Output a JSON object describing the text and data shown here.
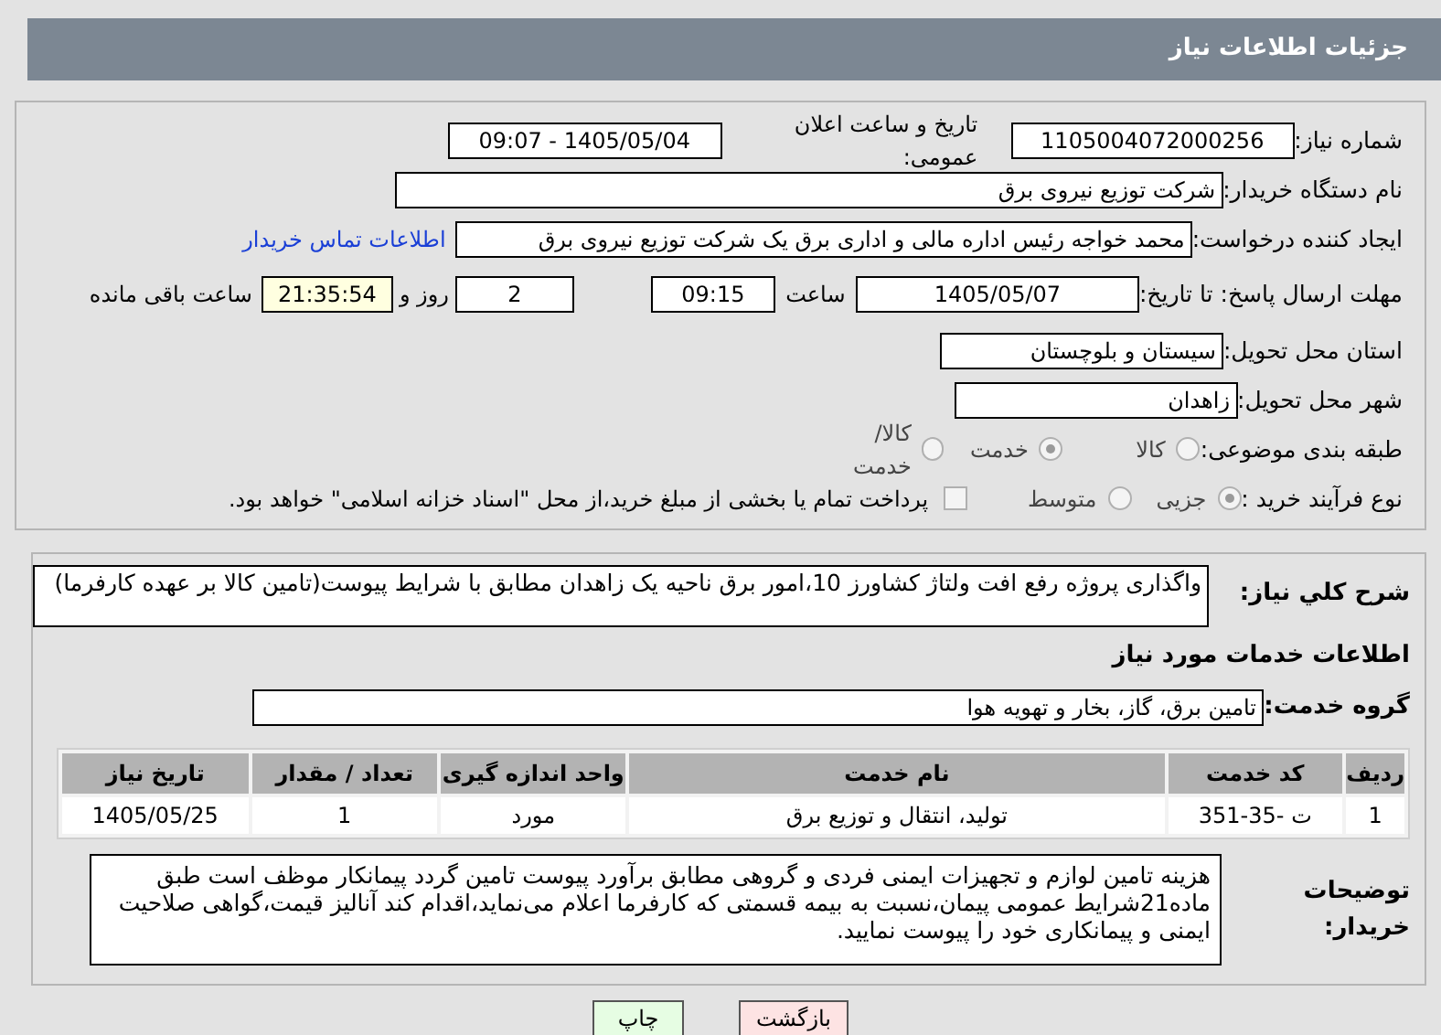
{
  "header": {
    "title": "جزئیات اطلاعات نیاز"
  },
  "details": {
    "need_number": {
      "label": "شماره نیاز:",
      "value": "1105004072000256"
    },
    "announce": {
      "label": "تاریخ و ساعت اعلان عمومی:",
      "value": "1405/05/04 - 09:07"
    },
    "buyer": {
      "label": "نام دستگاه خریدار:",
      "value": "شرکت توزیع نیروی برق"
    },
    "creator": {
      "label": "ایجاد کننده درخواست:",
      "value": "محمد خواجه رئیس اداره مالی و اداری برق یک شرکت توزیع نیروی برق",
      "link": "اطلاعات تماس خریدار"
    },
    "deadline": {
      "label": "مهلت ارسال پاسخ: تا تاریخ:",
      "date": "1405/05/07",
      "time_label": "ساعت",
      "time": "09:15",
      "days": "2",
      "days_label": "روز و",
      "remaining": "21:35:54",
      "remaining_label": "ساعت باقی مانده"
    },
    "province": {
      "label": "استان محل تحویل:",
      "value": "سیستان و بلوچستان"
    },
    "city": {
      "label": "شهر محل تحویل:",
      "value": "زاهدان"
    },
    "category": {
      "label": "طبقه بندی موضوعی:",
      "options": [
        {
          "label": "کالا",
          "selected": false
        },
        {
          "label": "خدمت",
          "selected": true
        },
        {
          "label": "کالا/خدمت",
          "selected": false
        }
      ]
    },
    "process": {
      "label": "نوع فرآیند خرید :",
      "options": [
        {
          "label": "جزیی",
          "selected": true
        },
        {
          "label": "متوسط",
          "selected": false
        }
      ],
      "payment": {
        "label": "پرداخت تمام یا بخشی از مبلغ خرید،از محل \"اسناد خزانه اسلامی\" خواهد بود.",
        "checked": false
      }
    }
  },
  "summary": {
    "label": "شرح کلي نياز:",
    "value": "واگذاری پروژه رفع افت ولتاژ کشاورز 10،امور برق ناحیه یک زاهدان مطابق با شرایط پیوست(تامین کالا بر عهده کارفرما)"
  },
  "services": {
    "heading": "اطلاعات خدمات مورد نیاز",
    "group_label": "گروه خدمت:",
    "group": "تامین برق، گاز، بخار و تهویه هوا",
    "table": {
      "columns": [
        "ردیف",
        "کد خدمت",
        "نام خدمت",
        "واحد اندازه گیری",
        "تعداد / مقدار",
        "تاریخ نیاز"
      ],
      "rows": [
        [
          "1",
          "ت -35-351",
          "تولید، انتقال و توزیع برق",
          "مورد",
          "1",
          "1405/05/25"
        ]
      ]
    }
  },
  "notes": {
    "label": "توضیحات خریدار:",
    "value": "هزینه تامین لوازم و تجهیزات ایمنی فردی و گروهی مطابق برآورد پیوست تامین گردد پیمانکار موظف است طبق ماده21شرایط عمومی پیمان،نسبت به بیمه قسمتی که کارفرما اعلام می‌نماید،اقدام کند آنالیز قیمت،گواهی صلاحیت ایمنی و پیمانکاری خود را پیوست نمایید."
  },
  "buttons": [
    {
      "label": "بازگشت",
      "kind": "back"
    },
    {
      "label": "چاپ",
      "kind": "print"
    }
  ]
}
